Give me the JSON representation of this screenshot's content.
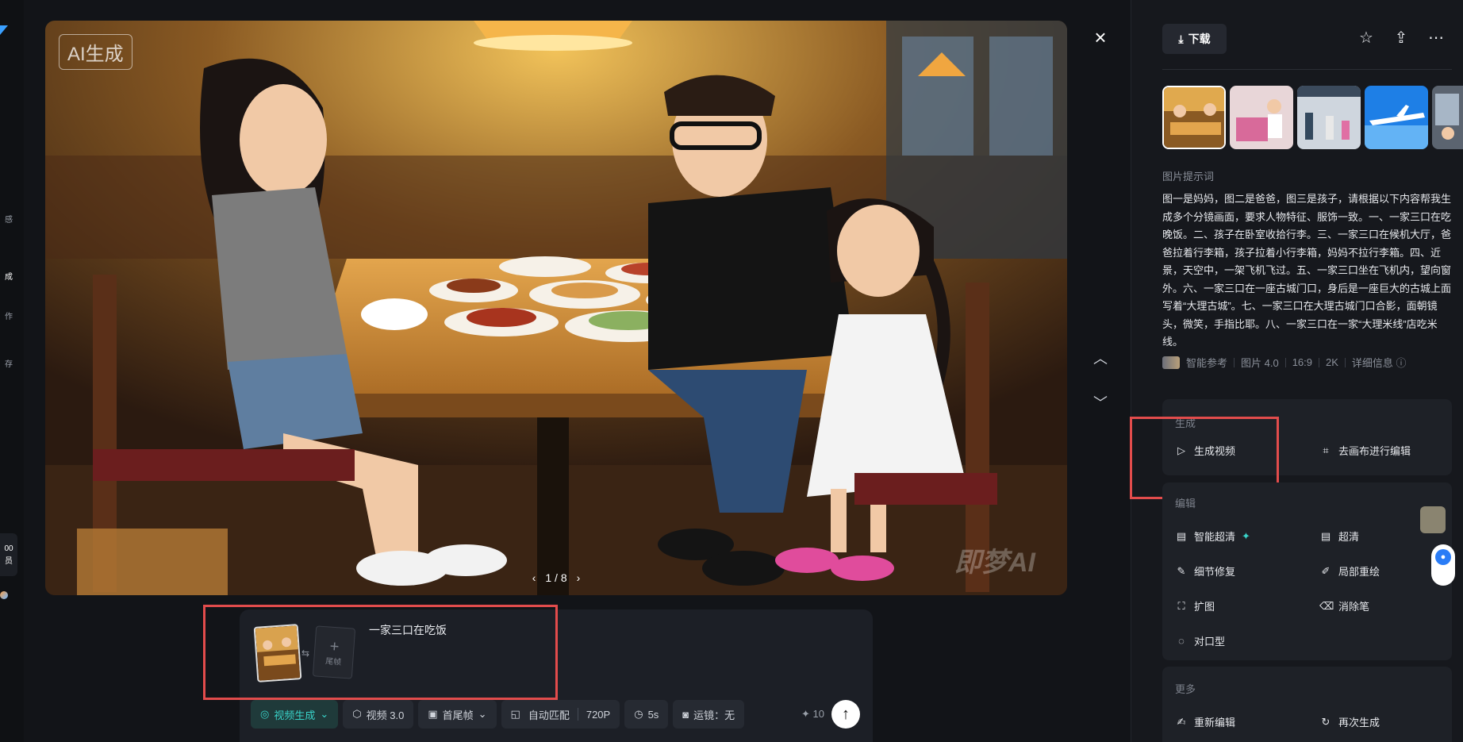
{
  "viewer": {
    "ai_badge": "AI生成",
    "watermark": "即梦AI",
    "pager": "1 / 8",
    "prev": "‹",
    "next": "›",
    "close": "×",
    "up": "︿",
    "down": "﹀"
  },
  "left_strip": {
    "items": [
      "感",
      "成",
      "作",
      "存"
    ],
    "badge_top": "00",
    "badge_bottom": "员"
  },
  "composer": {
    "prompt": "一家三口在吃饭",
    "tail_label": "尾帧",
    "swap": "⇆",
    "plus": "+",
    "toolbar": {
      "mode": "视频生成",
      "model": "视频 3.0",
      "frames": "首尾帧",
      "ratio": "自动匹配",
      "resolution": "720P",
      "duration": "5s",
      "camera": "运镜：无"
    },
    "credit": "✦ 10",
    "send": "↑"
  },
  "panel": {
    "download": "下载",
    "prompt_label": "图片提示词",
    "prompt_text": "图一是妈妈，图二是爸爸，图三是孩子，请根据以下内容帮我生成多个分镜画面，要求人物特征、服饰一致。一、一家三口在吃晚饭。二、孩子在卧室收拾行李。三、一家三口在候机大厅，爸爸拉着行李箱，孩子拉着小行李箱，妈妈不拉行李箱。四、近景，天空中，一架飞机飞过。五、一家三口坐在飞机内，望向窗外。六、一家三口在一座古城门口，身后是一座巨大的古城上面写着“大理古城”。七、一家三口在大理古城门口合影，面朝镜头，微笑，手指比耶。八、一家三口在一家“大理米线”店吃米线。",
    "meta": {
      "ref": "智能参考",
      "model": "图片 4.0",
      "ratio": "16:9",
      "res": "2K",
      "detail": "详细信息 ⓘ"
    },
    "generate": {
      "title": "生成",
      "video": "生成视频",
      "canvas": "去画布进行编辑"
    },
    "edit": {
      "title": "编辑",
      "smart_hd": "智能超清",
      "hd": "超清",
      "detail_fix": "细节修复",
      "local_redraw": "局部重绘",
      "expand": "扩图",
      "eraser": "消除笔",
      "lip_sync": "对口型"
    },
    "more": {
      "title": "更多",
      "re_edit": "重新编辑",
      "regenerate": "再次生成"
    }
  },
  "icons": {
    "download": "download-icon",
    "star": "star-icon",
    "share": "share-icon",
    "more": "more-icon",
    "close": "close-icon"
  }
}
